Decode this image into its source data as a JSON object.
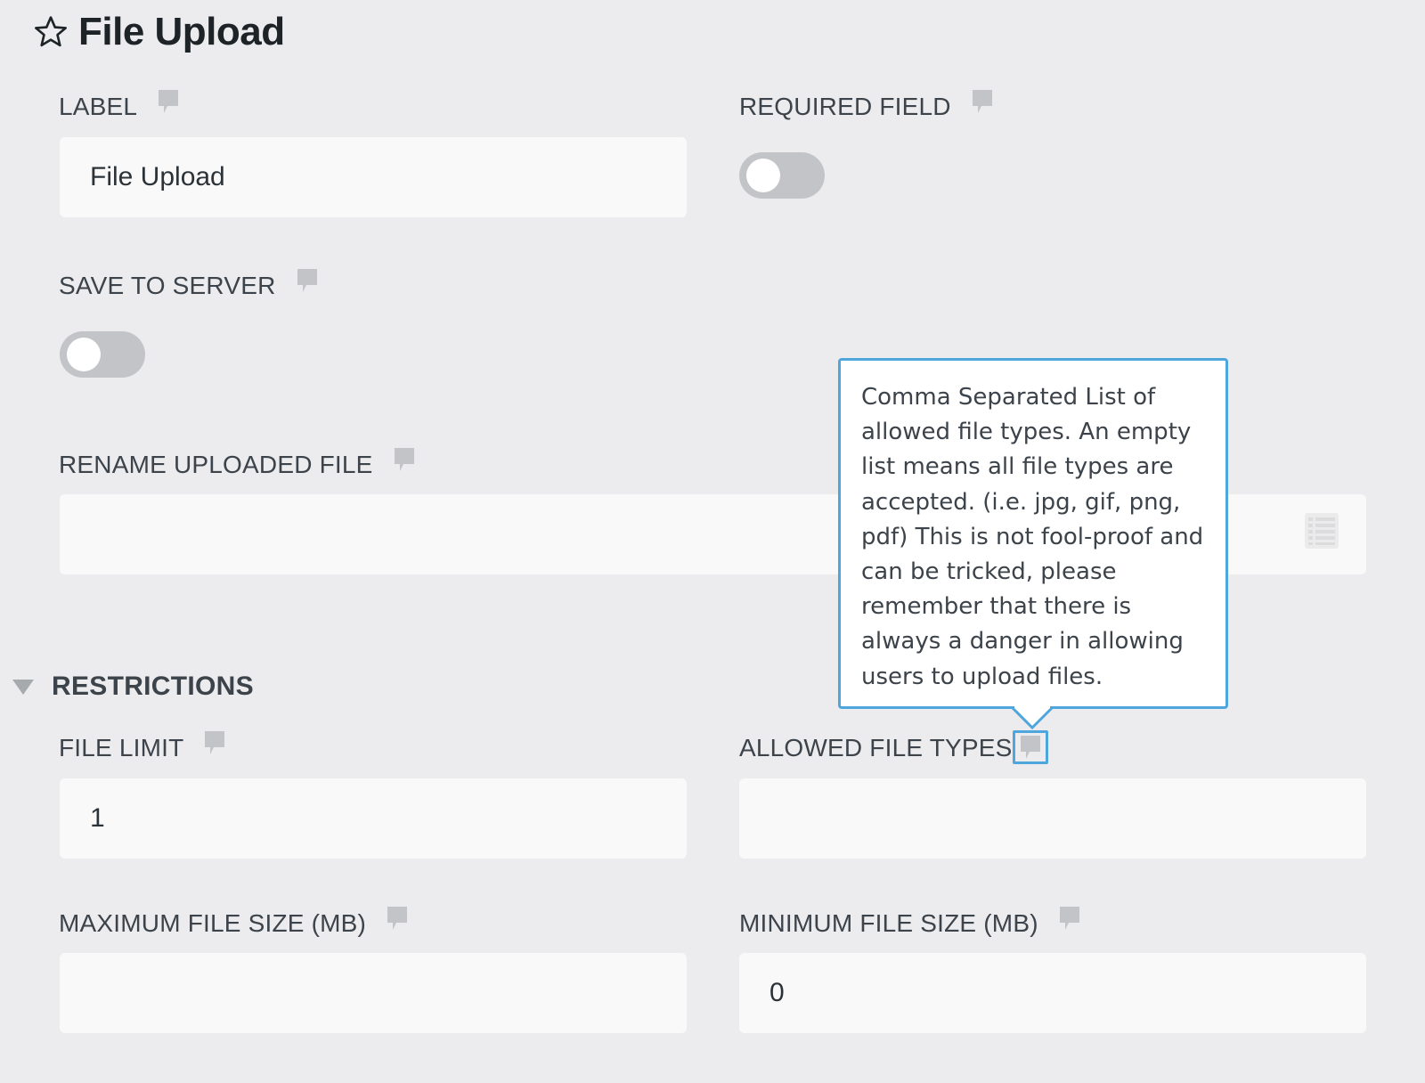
{
  "header": {
    "star_icon": "star-outline-icon",
    "title": "File Upload"
  },
  "fields": {
    "label": {
      "label": "LABEL",
      "value": "File Upload"
    },
    "required": {
      "label": "REQUIRED FIELD",
      "enabled": false
    },
    "save_to_server": {
      "label": "SAVE TO SERVER",
      "enabled": false
    },
    "rename": {
      "label": "RENAME UPLOADED FILE",
      "value": ""
    }
  },
  "restrictions": {
    "title": "RESTRICTIONS",
    "file_limit": {
      "label": "FILE LIMIT",
      "value": "1"
    },
    "allowed_types": {
      "label": "ALLOWED FILE TYPES",
      "value": ""
    },
    "max_size": {
      "label": "MAXIMUM FILE SIZE (MB)",
      "value": ""
    },
    "min_size": {
      "label": "MINIMUM FILE SIZE (MB)",
      "value": "0"
    }
  },
  "tooltip": {
    "text": "Comma Separated List of allowed file types. An empty list means all file types are accepted. (i.e. jpg, gif, png, pdf) This is not fool-proof and can be tricked, please remember that there is always a danger in allowing users to upload files."
  },
  "colors": {
    "background": "#ececee",
    "input_bg": "#f9f9f9",
    "toggle_off": "#c3c4c7",
    "tooltip_border": "#4ea6dc",
    "help_icon": "#c3c4c7"
  }
}
